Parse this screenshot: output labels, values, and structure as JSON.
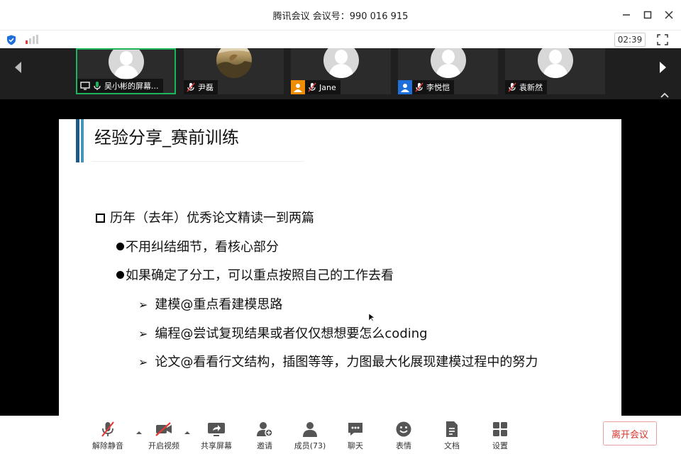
{
  "window": {
    "title": "腾讯会议 会议号：990 016 915"
  },
  "infobar": {
    "timer": "02:39"
  },
  "participants": [
    {
      "name": "吴小彬的屏幕...",
      "mic": "on",
      "badge": "screen",
      "active": true
    },
    {
      "name": "尹磊",
      "mic": "muted",
      "badge": "none",
      "photo": true
    },
    {
      "name": "Jane",
      "mic": "muted",
      "badge": "orange-user"
    },
    {
      "name": "李悦恺",
      "mic": "muted",
      "badge": "blue-user"
    },
    {
      "name": "袁新然",
      "mic": "muted",
      "badge": "none"
    }
  ],
  "slide": {
    "title": "经验分享_赛前训练",
    "bullets": [
      {
        "level": 1,
        "text": "历年（去年）优秀论文精读一到两篇"
      },
      {
        "level": 2,
        "text": "不用纠结细节，看核心部分"
      },
      {
        "level": 2,
        "text": "如果确定了分工，可以重点按照自己的工作去看"
      },
      {
        "level": 3,
        "text": "建模@重点看建模思路"
      },
      {
        "level": 3,
        "text": "编程@尝试复现结果或者仅仅想想要怎么coding"
      },
      {
        "level": 3,
        "text": "论文@看看行文结构，插图等等，力图最大化展现建模过程中的努力"
      }
    ]
  },
  "toolbar": {
    "unmute": "解除静音",
    "video": "开启视频",
    "share": "共享屏幕",
    "invite": "邀请",
    "members": "成员(73)",
    "chat": "聊天",
    "reactions": "表情",
    "docs": "文档",
    "settings": "设置",
    "leave": "离开会议"
  },
  "colors": {
    "accent_green": "#1db55c",
    "leave_red": "#d9342b",
    "mute_red": "#e53935",
    "slide_bar_dark": "#1c5b85",
    "slide_bar_light": "#4c93bb"
  }
}
